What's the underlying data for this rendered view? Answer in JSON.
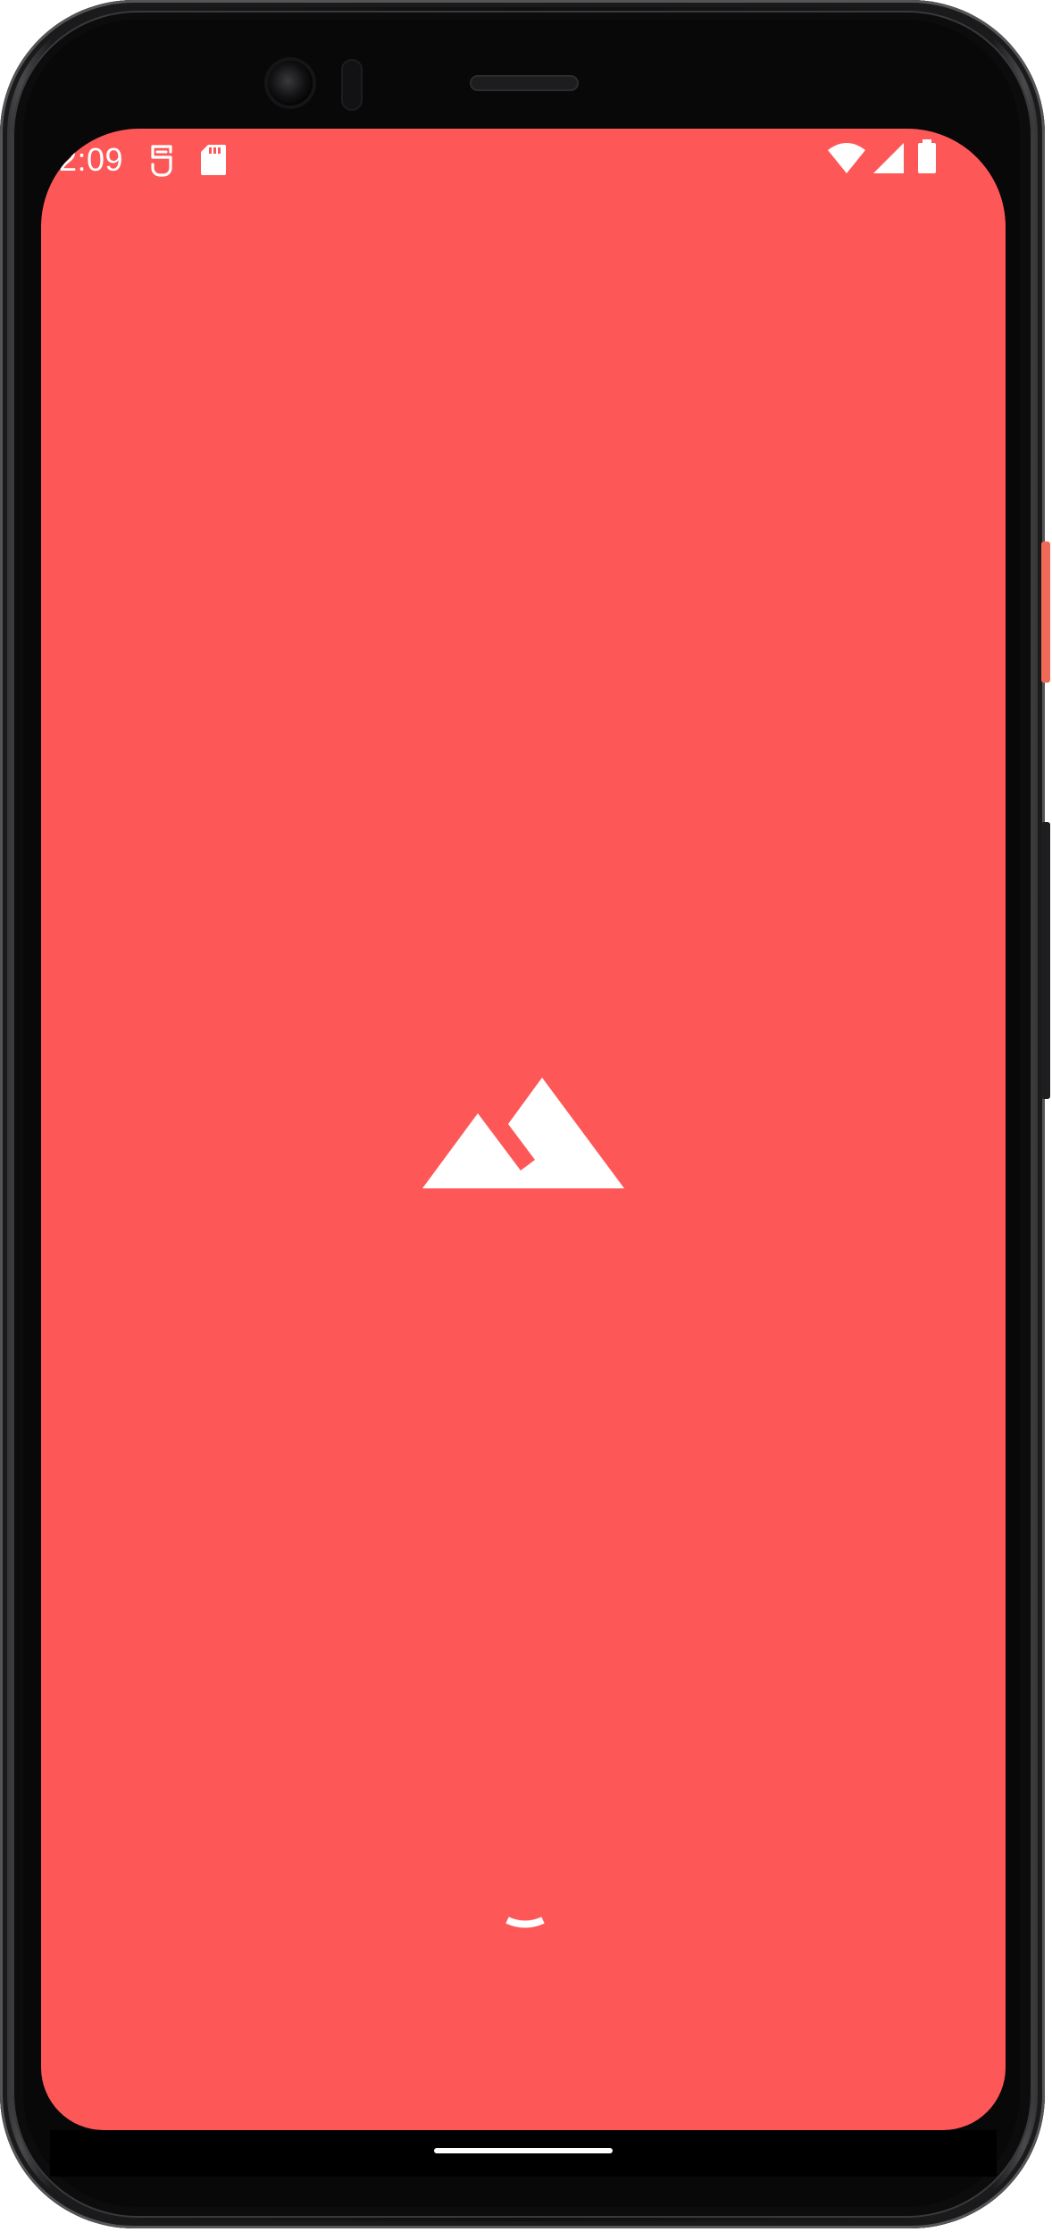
{
  "status_bar": {
    "time": "2:09",
    "icons": [
      "sim-toolkit-icon",
      "sd-card-icon",
      "wifi-icon",
      "cellular-signal-icon",
      "battery-icon"
    ]
  },
  "screen": {
    "background_color": "#fe5757",
    "logo_icon": "mountain-logo-icon",
    "loading_indicator": "loading-spinner"
  },
  "navigation": {
    "gesture_bar": "home-gesture-pill"
  }
}
